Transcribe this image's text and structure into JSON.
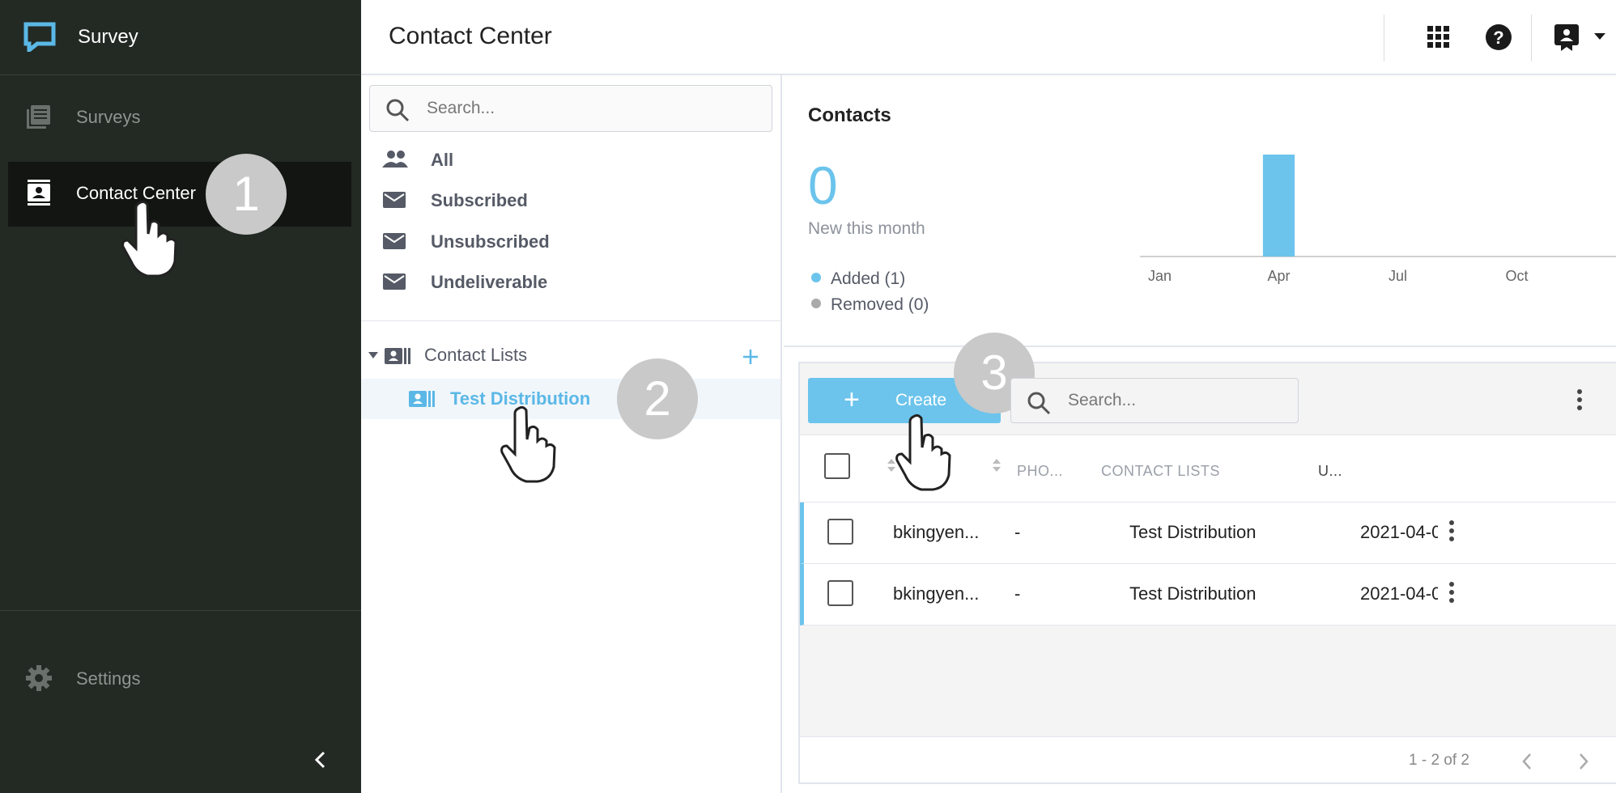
{
  "app": {
    "name": "Survey",
    "accent": "#6cc4ec"
  },
  "sidebar": {
    "items": [
      {
        "label": "Surveys",
        "icon": "list-icon"
      },
      {
        "label": "Contact Center",
        "icon": "contact-icon",
        "active": true
      }
    ],
    "settings_label": "Settings",
    "collapse_icon": "chevron-left-icon"
  },
  "header": {
    "title": "Contact Center"
  },
  "filter": {
    "search_placeholder": "Search...",
    "items": [
      {
        "label": "All",
        "icon": "people-icon"
      },
      {
        "label": "Subscribed",
        "icon": "mail-icon"
      },
      {
        "label": "Unsubscribed",
        "icon": "mail-icon"
      },
      {
        "label": "Undeliverable",
        "icon": "mail-icon"
      }
    ],
    "contact_lists_label": "Contact Lists",
    "lists": [
      {
        "label": "Test Distribution"
      }
    ]
  },
  "contacts": {
    "title": "Contacts",
    "new_count": "0",
    "new_label": "New this month",
    "legend": [
      {
        "label": "Added (1)",
        "color": "#6cc4ec"
      },
      {
        "label": "Removed (0)",
        "color": "#aaaaaa"
      }
    ]
  },
  "chart_data": {
    "type": "bar",
    "categories": [
      "Jan",
      "Feb",
      "Mar",
      "Apr",
      "May",
      "Jun",
      "Jul",
      "Aug",
      "Sep",
      "Oct",
      "Nov",
      "Dec"
    ],
    "x_tick_labels": [
      "Jan",
      "Apr",
      "Jul",
      "Oct"
    ],
    "values": [
      0,
      0,
      0,
      1,
      0,
      0,
      0,
      0,
      0,
      0,
      0,
      0
    ],
    "ylim": [
      0,
      1
    ],
    "color": "#6cc4ec"
  },
  "table": {
    "create_label": "Create",
    "search_placeholder": "Search...",
    "columns": [
      "PHO...",
      "CONTACT LISTS",
      "U..."
    ],
    "rows": [
      {
        "name": "bkingyen...",
        "phone": "-",
        "list": "Test Distribution",
        "date": "2021-04-0"
      },
      {
        "name": "bkingyen...",
        "phone": "-",
        "list": "Test Distribution",
        "date": "2021-04-0"
      }
    ],
    "pagination": "1 - 2 of 2"
  },
  "steps": [
    "1",
    "2",
    "3"
  ]
}
